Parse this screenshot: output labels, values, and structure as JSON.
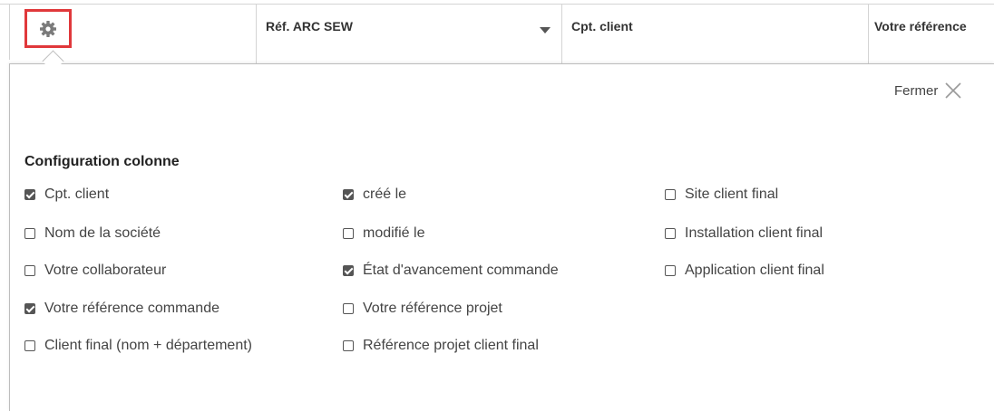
{
  "header": {
    "columns": [
      {
        "label": ""
      },
      {
        "label": "Réf. ARC SEW"
      },
      {
        "label": "Cpt. client"
      },
      {
        "label": "Votre référence"
      }
    ]
  },
  "panel": {
    "close_label": "Fermer",
    "section_title": "Configuration colonne",
    "options": [
      {
        "label": "Cpt. client",
        "checked": true
      },
      {
        "label": "Nom de la société",
        "checked": false
      },
      {
        "label": "Votre collaborateur",
        "checked": false
      },
      {
        "label": "Votre référence commande",
        "checked": true
      },
      {
        "label": "Client final (nom + département)",
        "checked": false
      },
      {
        "label": "créé le",
        "checked": true
      },
      {
        "label": "modifié le",
        "checked": false
      },
      {
        "label": "État d'avancement commande",
        "checked": true
      },
      {
        "label": "Votre référence projet",
        "checked": false
      },
      {
        "label": "Référence projet client final",
        "checked": false
      },
      {
        "label": "Site client final",
        "checked": false
      },
      {
        "label": "Installation client final",
        "checked": false
      },
      {
        "label": "Application client final",
        "checked": false
      }
    ]
  },
  "colors": {
    "highlight": "#e0383b",
    "border": "#d4d4d4",
    "text": "#444444"
  },
  "icons": {
    "settings": "gear-icon",
    "sort": "caret-down-icon",
    "close": "close-icon"
  }
}
